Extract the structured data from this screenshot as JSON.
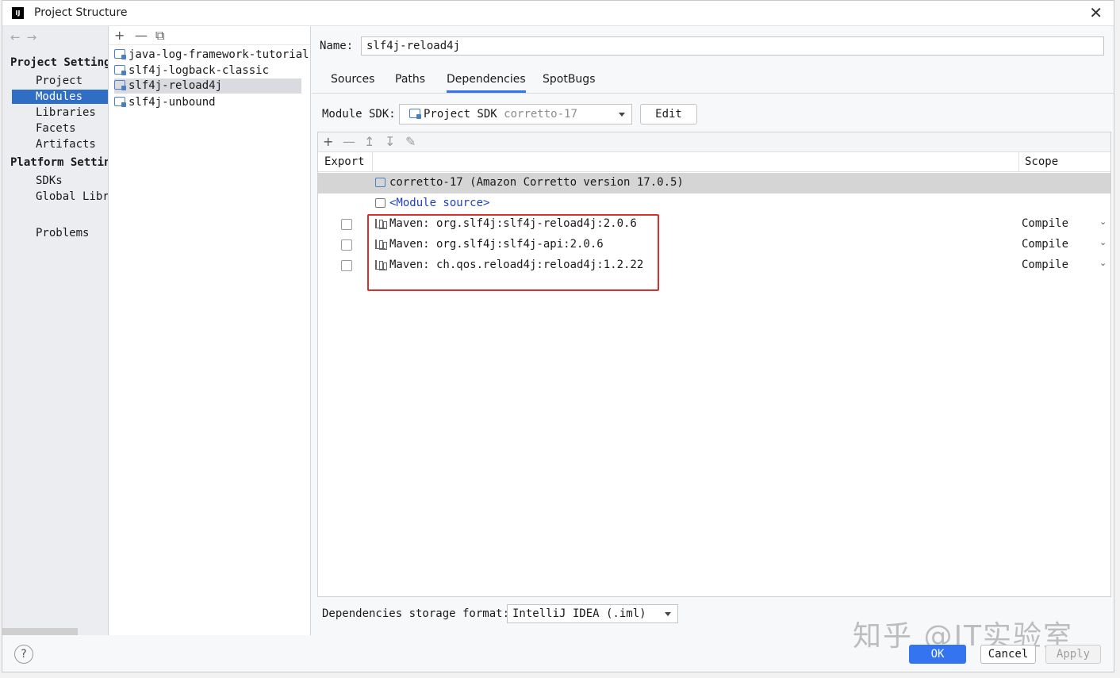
{
  "window": {
    "title": "Project Structure",
    "app_icon_text": "IJ",
    "close_glyph": "✕"
  },
  "nav": {
    "back_glyph": "←",
    "forward_glyph": "→",
    "project_settings_heading": "Project Settings",
    "project_settings_items": [
      "Project",
      "Modules",
      "Libraries",
      "Facets",
      "Artifacts"
    ],
    "selected_item": "Modules",
    "platform_settings_heading": "Platform Settings",
    "platform_settings_items": [
      "SDKs",
      "Global Libraries"
    ],
    "problems": "Problems"
  },
  "modules": {
    "toolbar": {
      "add": "+",
      "remove": "—",
      "copy": "⧉"
    },
    "items": [
      "java-log-framework-tutorial",
      "slf4j-logback-classic",
      "slf4j-reload4j",
      "slf4j-unbound"
    ],
    "selected": "slf4j-reload4j"
  },
  "detail": {
    "name_label": "Name:",
    "name_value": "slf4j-reload4j",
    "tabs": [
      "Sources",
      "Paths",
      "Dependencies",
      "SpotBugs"
    ],
    "active_tab": "Dependencies",
    "sdk_label": "Module SDK:",
    "sdk_value": "Project SDK",
    "sdk_value_dim": "corretto-17",
    "edit_label": "Edit",
    "deps_toolbar": {
      "add": "+",
      "remove": "—",
      "up": "↥",
      "down": "↧",
      "edit": "✎"
    },
    "columns": {
      "export": "Export",
      "scope": "Scope"
    },
    "rows": [
      {
        "text": "corretto-17 (Amazon Corretto version 17.0.5)",
        "icon": "sdk-folder-icon",
        "checkbox": false,
        "scope": ""
      },
      {
        "text": "<Module source>",
        "icon": "source-folder-icon",
        "checkbox": false,
        "scope": ""
      },
      {
        "text": "Maven: org.slf4j:slf4j-reload4j:2.0.6",
        "icon": "library-icon",
        "checkbox": true,
        "scope": "Compile"
      },
      {
        "text": "Maven: org.slf4j:slf4j-api:2.0.6",
        "icon": "library-icon",
        "checkbox": true,
        "scope": "Compile"
      },
      {
        "text": "Maven: ch.qos.reload4j:reload4j:1.2.22",
        "icon": "library-icon",
        "checkbox": true,
        "scope": "Compile"
      }
    ],
    "scope_chevron": "⌄",
    "format_label": "Dependencies storage format:",
    "format_value": "IntelliJ IDEA (.iml)"
  },
  "footer": {
    "help": "?",
    "ok": "OK",
    "cancel": "Cancel",
    "apply": "Apply"
  },
  "watermark": "知乎 @IT实验室",
  "colors": {
    "accent": "#3574f0",
    "selection": "#2f6ec4",
    "highlight_box": "#d9302c"
  }
}
